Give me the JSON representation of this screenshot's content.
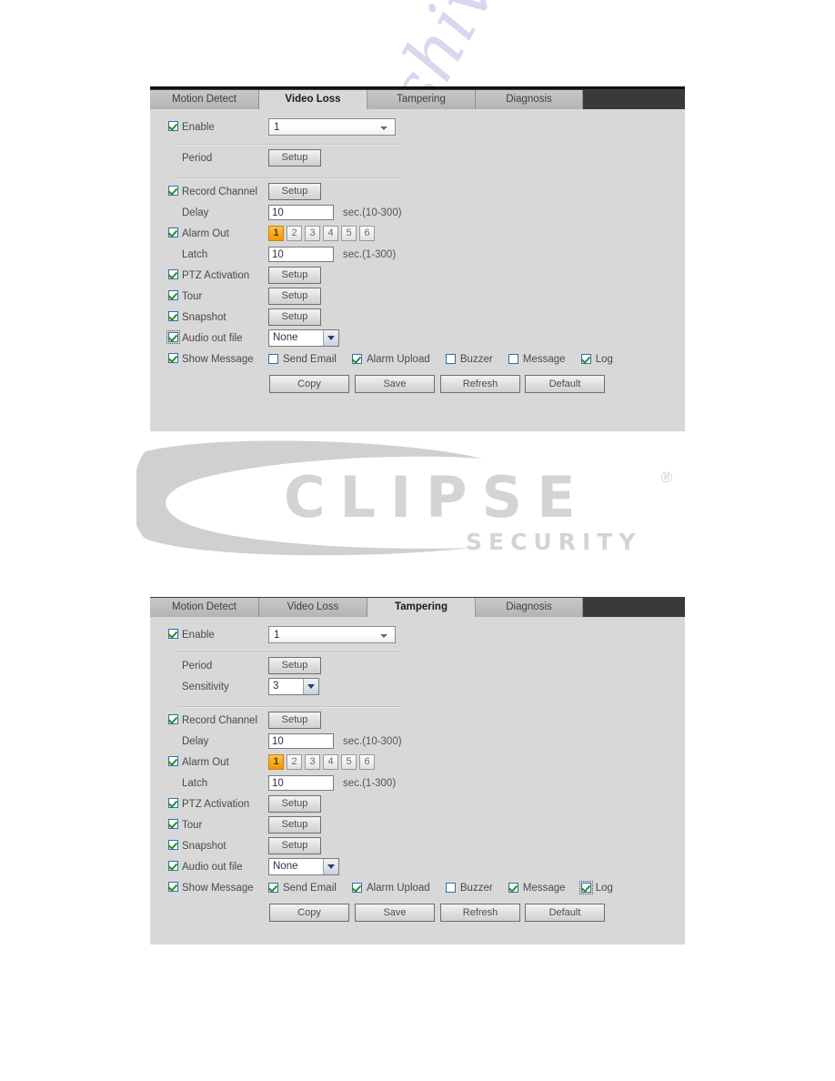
{
  "watermarks": {
    "site": "manualshive.com",
    "logo_text": "ECLIPSE",
    "logo_sub": "SECURITY",
    "logo_reg": "®"
  },
  "common": {
    "setup_label": "Setup",
    "alarm_out_channels": [
      "1",
      "2",
      "3",
      "4",
      "5",
      "6"
    ],
    "delay_unit": "sec.(10-300)",
    "latch_unit": "sec.(1-300)",
    "audio_none": "None",
    "actions": {
      "copy": "Copy",
      "save": "Save",
      "refresh": "Refresh",
      "default": "Default"
    },
    "labels": {
      "enable": "Enable",
      "period": "Period",
      "sensitivity": "Sensitivity",
      "record_channel": "Record Channel",
      "delay": "Delay",
      "alarm_out": "Alarm Out",
      "latch": "Latch",
      "ptz_activation": "PTZ Activation",
      "tour": "Tour",
      "snapshot": "Snapshot",
      "audio_out_file": "Audio out file",
      "show_message": "Show Message",
      "send_email": "Send Email",
      "alarm_upload": "Alarm Upload",
      "buzzer": "Buzzer",
      "message": "Message",
      "log": "Log"
    }
  },
  "colors": {
    "panel_bg": "#d8d8d8",
    "tab_inactive": "#bdbdbd",
    "tab_bar_dark": "#3a3a3a",
    "alarm_active": "#f5a81a",
    "check_green": "#2a8a2a",
    "check_border": "#2e6fa8",
    "watermark_purple": "#b9b7e2",
    "logo_gray": "#d0d0d0"
  },
  "panel1": {
    "tabs": [
      {
        "label": "Motion Detect",
        "active": false
      },
      {
        "label": "Video Loss",
        "active": true
      },
      {
        "label": "Tampering",
        "active": false
      },
      {
        "label": "Diagnosis",
        "active": false
      }
    ],
    "enable": {
      "checked": true,
      "channel": "1"
    },
    "period": {
      "button": "Setup"
    },
    "record_channel": {
      "checked": true,
      "button": "Setup"
    },
    "delay": {
      "value": "10",
      "unit": "sec.(10-300)"
    },
    "alarm_out": {
      "checked": true,
      "selected": "1"
    },
    "latch": {
      "value": "10",
      "unit": "sec.(1-300)"
    },
    "ptz_activation": {
      "checked": true,
      "button": "Setup"
    },
    "tour": {
      "checked": true,
      "button": "Setup"
    },
    "snapshot": {
      "checked": true,
      "button": "Setup"
    },
    "audio_out_file": {
      "checked": true,
      "focus": true,
      "value": "None"
    },
    "show_message": {
      "checked": true
    },
    "notify": [
      {
        "label": "Send Email",
        "checked": false,
        "focus": false
      },
      {
        "label": "Alarm Upload",
        "checked": true,
        "focus": false
      },
      {
        "label": "Buzzer",
        "checked": false,
        "focus": false
      },
      {
        "label": "Message",
        "checked": false,
        "focus": false
      },
      {
        "label": "Log",
        "checked": true,
        "focus": false
      }
    ]
  },
  "panel2": {
    "tabs": [
      {
        "label": "Motion Detect",
        "active": false
      },
      {
        "label": "Video Loss",
        "active": false
      },
      {
        "label": "Tampering",
        "active": true
      },
      {
        "label": "Diagnosis",
        "active": false
      }
    ],
    "enable": {
      "checked": true,
      "channel": "1"
    },
    "period": {
      "button": "Setup"
    },
    "sensitivity": {
      "value": "3"
    },
    "record_channel": {
      "checked": true,
      "button": "Setup"
    },
    "delay": {
      "value": "10",
      "unit": "sec.(10-300)"
    },
    "alarm_out": {
      "checked": true,
      "selected": "1"
    },
    "latch": {
      "value": "10",
      "unit": "sec.(1-300)"
    },
    "ptz_activation": {
      "checked": true,
      "button": "Setup"
    },
    "tour": {
      "checked": true,
      "button": "Setup"
    },
    "snapshot": {
      "checked": true,
      "button": "Setup"
    },
    "audio_out_file": {
      "checked": true,
      "focus": false,
      "value": "None"
    },
    "show_message": {
      "checked": true
    },
    "notify": [
      {
        "label": "Send Email",
        "checked": true,
        "focus": false
      },
      {
        "label": "Alarm Upload",
        "checked": true,
        "focus": false
      },
      {
        "label": "Buzzer",
        "checked": false,
        "focus": false
      },
      {
        "label": "Message",
        "checked": true,
        "focus": false
      },
      {
        "label": "Log",
        "checked": true,
        "focus": true
      }
    ]
  }
}
